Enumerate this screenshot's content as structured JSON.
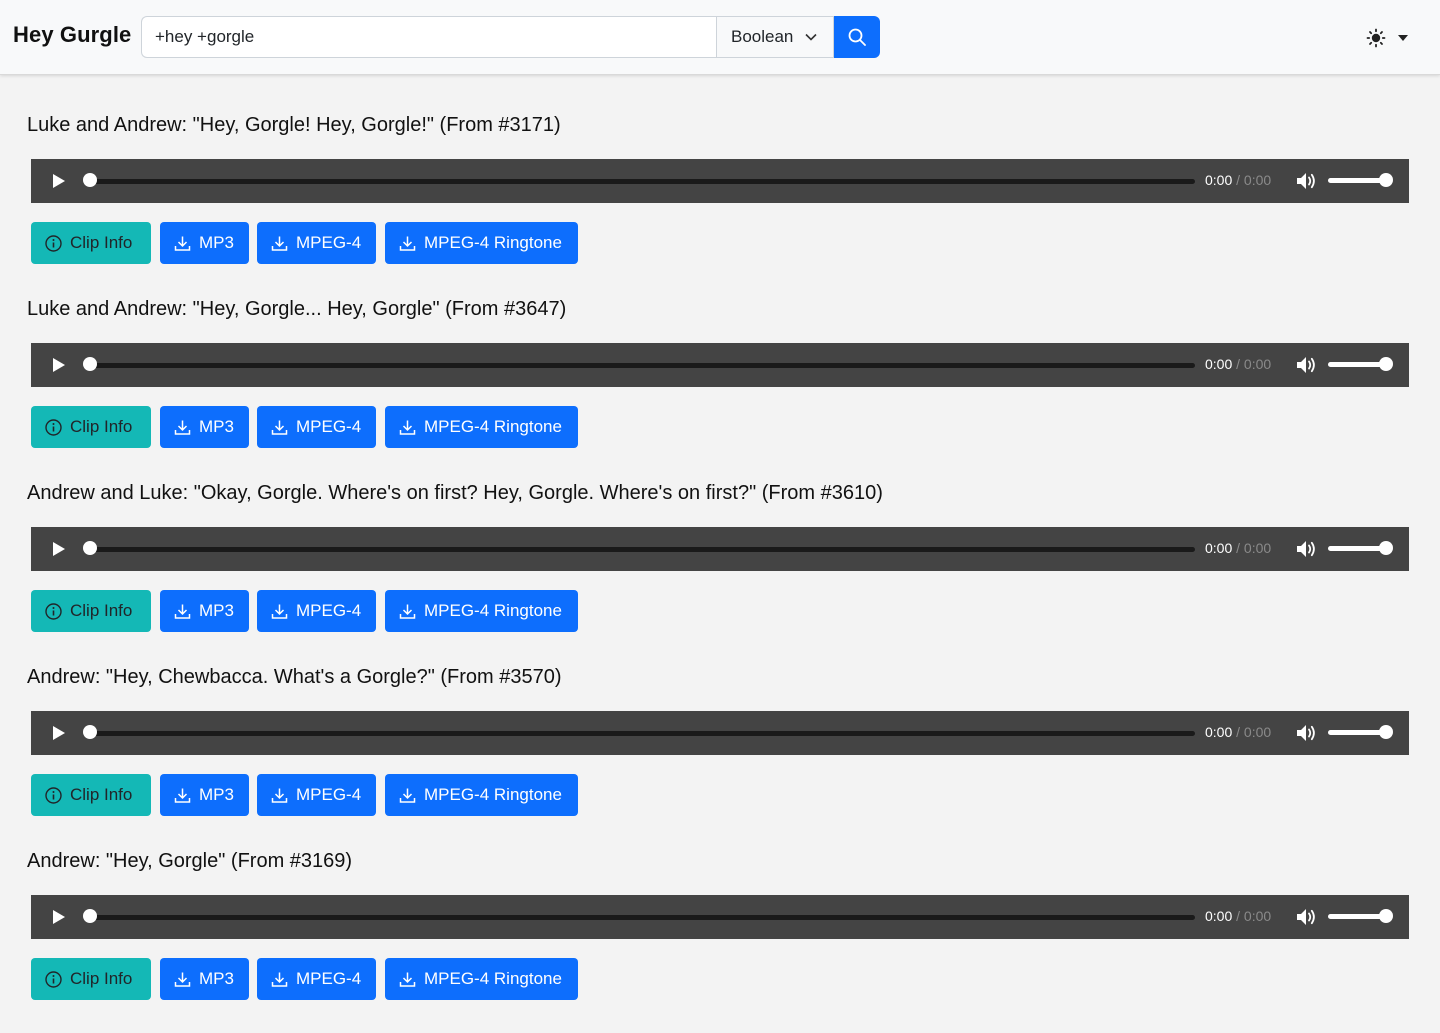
{
  "app": {
    "brand": "Hey Gurgle"
  },
  "search": {
    "value": "+hey +gorgle",
    "mode": "Boolean"
  },
  "clips": [
    {
      "title": "Luke and Andrew: \"Hey, Gorgle! Hey, Gorgle!\" (From #3171)",
      "current_time": "0:00",
      "separator": "/",
      "duration": "0:00",
      "volume": 1.0
    },
    {
      "title": "Luke and Andrew: \"Hey, Gorgle... Hey, Gorgle\" (From #3647)",
      "current_time": "0:00",
      "separator": "/",
      "duration": "0:00",
      "volume": 1.0
    },
    {
      "title": "Andrew and Luke: \"Okay, Gorgle. Where's on first? Hey, Gorgle. Where's on first?\" (From #3610)",
      "current_time": "0:00",
      "separator": "/",
      "duration": "0:00",
      "volume": 1.0
    },
    {
      "title": "Andrew: \"Hey, Chewbacca. What's a Gorgle?\" (From #3570)",
      "current_time": "0:00",
      "separator": "/",
      "duration": "0:00",
      "volume": 1.0
    },
    {
      "title": "Andrew: \"Hey, Gorgle\" (From #3169)",
      "current_time": "0:00",
      "separator": "/",
      "duration": "0:00",
      "volume": 1.0
    }
  ],
  "buttons": {
    "clip_info": "Clip Info",
    "mp3": "MP3",
    "mpeg4": "MPEG-4",
    "ringtone": "MPEG-4 Ringtone"
  },
  "colors": {
    "primary": "#0d6efd",
    "info": "#14b8b6",
    "player_bg": "#444444"
  },
  "icons": {
    "search": "search-icon",
    "theme": "sun-icon",
    "play": "play-icon",
    "volume": "volume-icon",
    "info": "info-circle-icon",
    "download": "download-icon"
  }
}
